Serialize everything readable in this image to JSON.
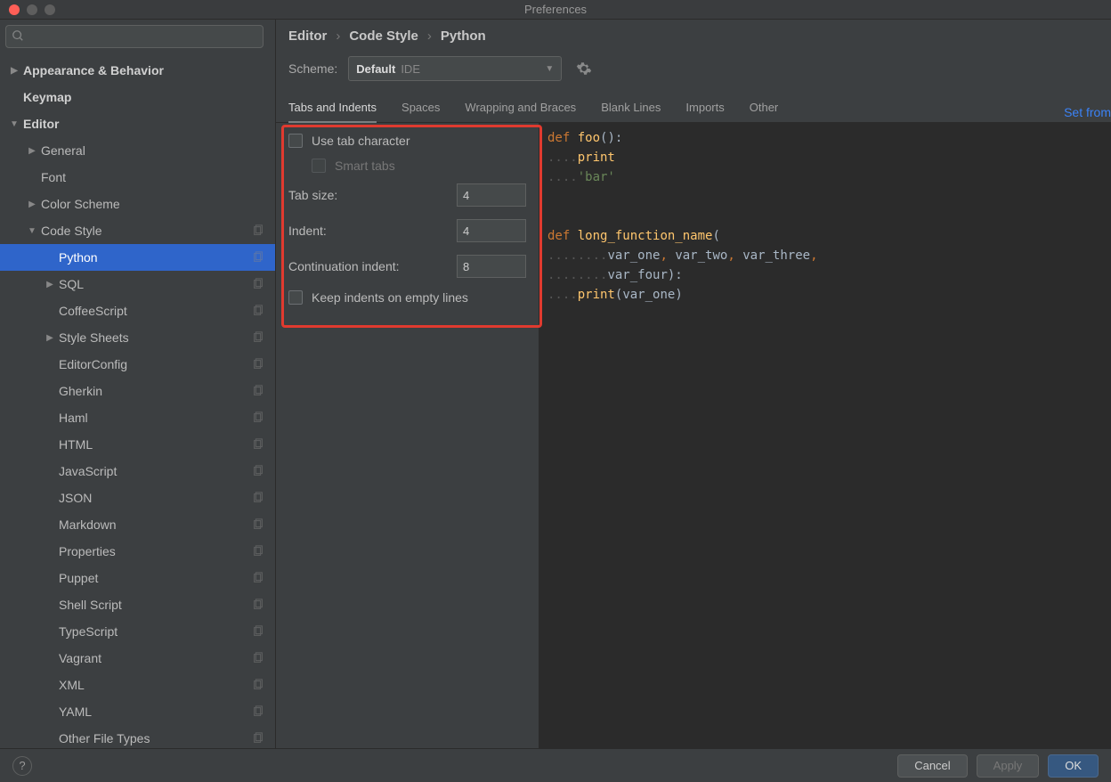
{
  "window": {
    "title": "Preferences"
  },
  "search": {
    "placeholder": ""
  },
  "sidebar": {
    "items": [
      {
        "label": "Appearance & Behavior",
        "indent": 0,
        "arrow": "right",
        "bold": true
      },
      {
        "label": "Keymap",
        "indent": 0,
        "arrow": "none",
        "bold": true
      },
      {
        "label": "Editor",
        "indent": 0,
        "arrow": "down",
        "bold": true
      },
      {
        "label": "General",
        "indent": 1,
        "arrow": "right"
      },
      {
        "label": "Font",
        "indent": 1,
        "arrow": "none"
      },
      {
        "label": "Color Scheme",
        "indent": 1,
        "arrow": "right"
      },
      {
        "label": "Code Style",
        "indent": 1,
        "arrow": "down",
        "copy": true
      },
      {
        "label": "Python",
        "indent": 2,
        "arrow": "none",
        "selected": true,
        "copy": true
      },
      {
        "label": "SQL",
        "indent": 2,
        "arrow": "right",
        "copy": true
      },
      {
        "label": "CoffeeScript",
        "indent": 2,
        "arrow": "none",
        "copy": true
      },
      {
        "label": "Style Sheets",
        "indent": 2,
        "arrow": "right",
        "copy": true
      },
      {
        "label": "EditorConfig",
        "indent": 2,
        "arrow": "none",
        "copy": true
      },
      {
        "label": "Gherkin",
        "indent": 2,
        "arrow": "none",
        "copy": true
      },
      {
        "label": "Haml",
        "indent": 2,
        "arrow": "none",
        "copy": true
      },
      {
        "label": "HTML",
        "indent": 2,
        "arrow": "none",
        "copy": true
      },
      {
        "label": "JavaScript",
        "indent": 2,
        "arrow": "none",
        "copy": true
      },
      {
        "label": "JSON",
        "indent": 2,
        "arrow": "none",
        "copy": true
      },
      {
        "label": "Markdown",
        "indent": 2,
        "arrow": "none",
        "copy": true
      },
      {
        "label": "Properties",
        "indent": 2,
        "arrow": "none",
        "copy": true
      },
      {
        "label": "Puppet",
        "indent": 2,
        "arrow": "none",
        "copy": true
      },
      {
        "label": "Shell Script",
        "indent": 2,
        "arrow": "none",
        "copy": true
      },
      {
        "label": "TypeScript",
        "indent": 2,
        "arrow": "none",
        "copy": true
      },
      {
        "label": "Vagrant",
        "indent": 2,
        "arrow": "none",
        "copy": true
      },
      {
        "label": "XML",
        "indent": 2,
        "arrow": "none",
        "copy": true
      },
      {
        "label": "YAML",
        "indent": 2,
        "arrow": "none",
        "copy": true
      },
      {
        "label": "Other File Types",
        "indent": 2,
        "arrow": "none",
        "copy": true
      }
    ]
  },
  "breadcrumb": {
    "a": "Editor",
    "b": "Code Style",
    "c": "Python"
  },
  "scheme": {
    "label": "Scheme:",
    "value": "Default",
    "tag": "IDE"
  },
  "setfrom": "Set from",
  "tabs": [
    "Tabs and Indents",
    "Spaces",
    "Wrapping and Braces",
    "Blank Lines",
    "Imports",
    "Other"
  ],
  "form": {
    "use_tab": "Use tab character",
    "smart_tabs": "Smart tabs",
    "tab_size_label": "Tab size:",
    "tab_size": "4",
    "indent_label": "Indent:",
    "indent": "4",
    "cont_label": "Continuation indent:",
    "cont": "8",
    "keep_empty": "Keep indents on empty lines"
  },
  "footer": {
    "cancel": "Cancel",
    "apply": "Apply",
    "ok": "OK"
  }
}
